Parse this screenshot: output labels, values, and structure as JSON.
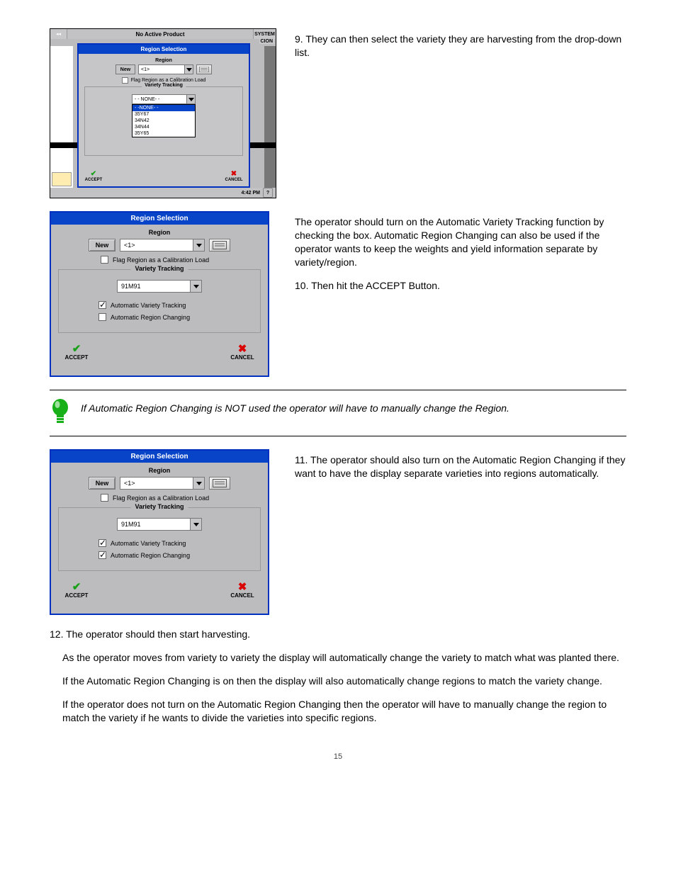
{
  "thumb1": {
    "topTitle": "No Active Product",
    "system": "SYSTEM",
    "tabTxt": "CION",
    "time": "4:42 PM"
  },
  "dialog": {
    "title": "Region Selection",
    "regionHeading": "Region",
    "newBtn": "New",
    "regionValue": "<1>",
    "flagLabel": "Flag Region as a Calibration Load",
    "vtLegend": "Variety Tracking",
    "ddValue1": "- - NONE- -",
    "ddOptions": [
      "- -NONE- -",
      "35Y67",
      "34N42",
      "34N44",
      "35Y65"
    ],
    "ddValue2": "91M91",
    "autoVariety": "Automatic Variety Tracking",
    "autoRegion": "Automatic Region Changing",
    "accept": "ACCEPT",
    "cancel": "CANCEL"
  },
  "text": {
    "p9": "9.   They can then select the variety they are harvesting from the drop-down list.",
    "p9b": "The operator should turn on the Automatic Variety Tracking function by checking the box. Automatic Region Changing can also be used if the operator wants to keep the weights and yield information separate by variety/region.",
    "p10": "10. Then hit the ACCEPT Button.",
    "tip": "If Automatic Region Changing is NOT used the operator will have to manually change the Region.",
    "p11": "11. The operator should also turn on the Automatic Region Changing if they want to have the display separate varieties into regions automatically.",
    "p12a": "12. The operator should then start harvesting.",
    "p12b": "As the operator moves from variety to variety the display will automatically change the variety to match what was planted there.",
    "p12c": "If the Automatic Region Changing is on then the display will also automatically change regions to match the variety change.",
    "p12d": "If the operator does not turn on the Automatic Region Changing then the operator will have to manually change the region to match the variety if he wants to divide the varieties into specific regions."
  },
  "pageNo": "15"
}
